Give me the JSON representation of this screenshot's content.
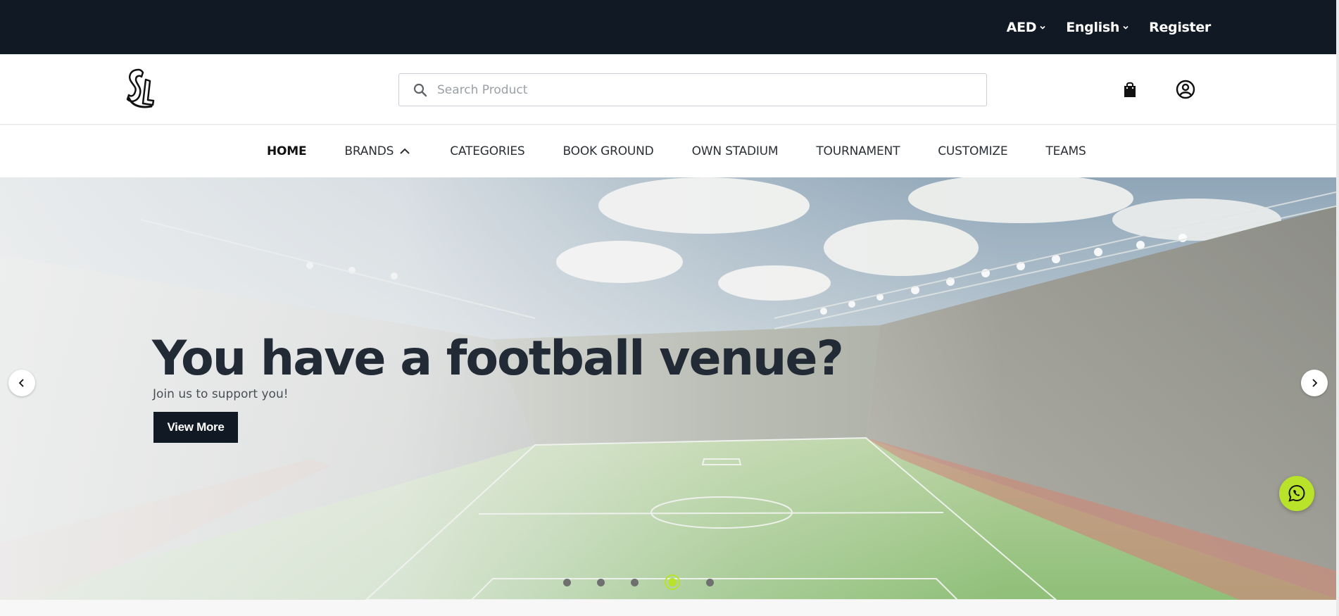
{
  "topbar": {
    "currency": "AED",
    "language": "English",
    "register": "Register"
  },
  "header": {
    "logo_text": "SL",
    "search": {
      "placeholder": "Search Product",
      "value": ""
    },
    "icons": [
      "bag-icon",
      "user-icon"
    ]
  },
  "nav": {
    "items": [
      {
        "label": "HOME",
        "active": true
      },
      {
        "label": "BRANDS"
      },
      {
        "label": "CATEGORIES"
      },
      {
        "label": "BOOK GROUND"
      },
      {
        "label": "OWN STADIUM"
      },
      {
        "label": "TOURNAMENT"
      },
      {
        "label": "CUSTOMIZE"
      },
      {
        "label": "TEAMS"
      }
    ]
  },
  "hero": {
    "title": "You have a football venue?",
    "subtitle": "Join us to support you!",
    "button": "View More",
    "slides": 5,
    "active_slide": 4
  },
  "colors": {
    "dark": "#111a24",
    "accent": "#b8e32a"
  }
}
